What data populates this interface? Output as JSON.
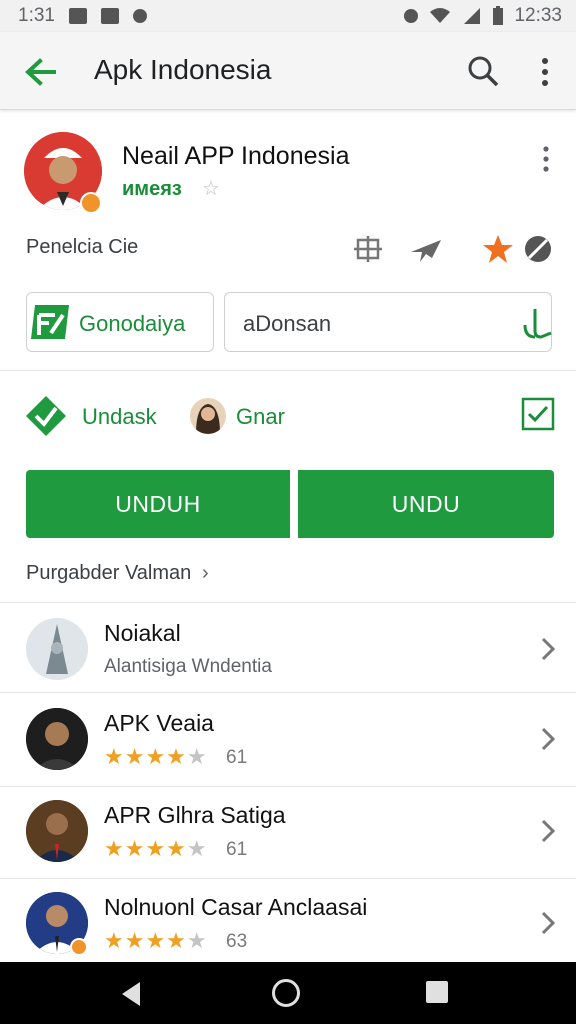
{
  "status_bar": {
    "time_left": "1:31",
    "time_right": "12:33",
    "left_icons": [
      "gallery-icon",
      "camera-icon",
      "location-icon"
    ],
    "right_icons": [
      "alarm-icon",
      "wifi-icon",
      "signal-icon",
      "battery-icon"
    ]
  },
  "app_bar": {
    "title": "Apk Indonesia",
    "back_icon": "back-arrow-icon",
    "search_icon": "search-icon",
    "more_icon": "more-vert-icon"
  },
  "app": {
    "name": "Neail APP Indonesia",
    "developer": "имеяз",
    "rating_star": "☆",
    "category": "Penelcia Cie"
  },
  "chips": {
    "left_label": "Gonodaiya",
    "right_label": "aDonsan"
  },
  "actions": {
    "left_label": "Undask",
    "right_label": "Gnar"
  },
  "install": {
    "left_label": "UNDUH",
    "right_label": "UNDU"
  },
  "section": {
    "title": "Purgabder Valman",
    "chevron": "›"
  },
  "list": [
    {
      "title": "Noiakal",
      "subtitle": "Alantisiga Wndentia",
      "stars": null,
      "count": null
    },
    {
      "title": "APK Veaia",
      "subtitle": null,
      "stars": 4,
      "count": "61"
    },
    {
      "title": "APR Glhra Satiga",
      "subtitle": null,
      "stars": 4,
      "count": "61"
    },
    {
      "title": "Nolnuonl Casar Anclaasai",
      "subtitle": null,
      "stars": 4,
      "count": "63"
    }
  ],
  "colors": {
    "brand_green": "#1f9a3e",
    "star_orange": "#f0a020",
    "accent_orange": "#f07020"
  }
}
